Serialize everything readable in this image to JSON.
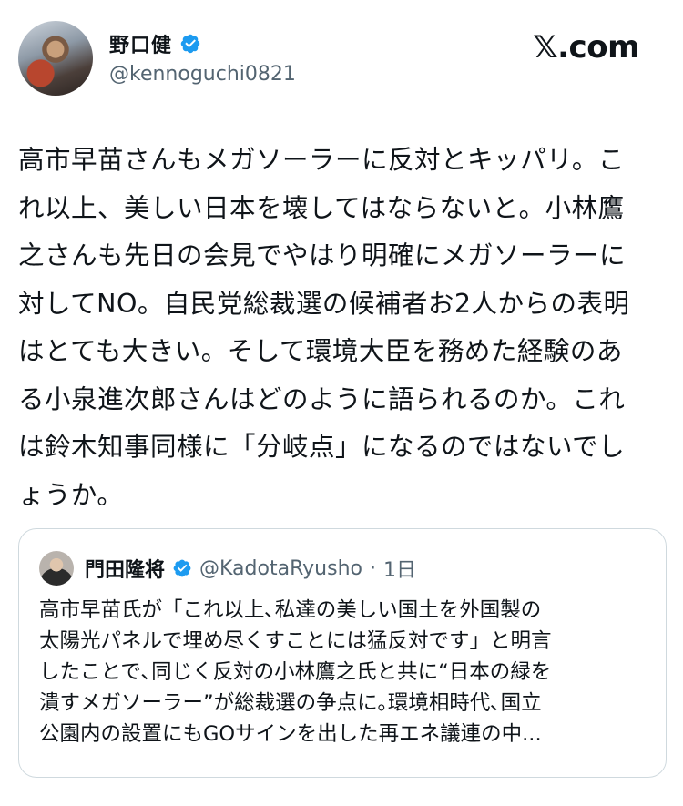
{
  "author": {
    "display_name": "野口健",
    "handle": "@kennoguchi0821",
    "verified": true
  },
  "brand": {
    "logo_text": "𝕏.com"
  },
  "tweet": {
    "text": "高市早苗さんもメガソーラーに反対とキッパリ。こ\nれ以上、美しい日本を壊してはならないと。小林鷹\n之さんも先日の会見でやはり明確にメガソーラーに\n対してNO。自民党総裁選の候補者お2人からの表明\nはとても大きい。そして環境大臣を務めた経験のあ\nる小泉進次郎さんはどのように語られるのか。これ\nは鈴木知事同様に「分岐点」になるのではないでし\nょうか。"
  },
  "quoted": {
    "display_name": "門田隆将",
    "handle": "@KadotaRyusho",
    "separator": "·",
    "time": "1日",
    "verified": true,
    "text": "高市早苗氏が「これ以上､私達の美しい国土を外国製の\n太陽光パネルで埋め尽くすことには猛反対です」と明言\nしたことで､同じく反対の小林鷹之氏と共に“日本の緑を\n潰すメガソーラー”が総裁選の争点に｡環境相時代､国立\n公園内の設置にもGOサインを出した再エネ議連の中..."
  },
  "colors": {
    "verified_blue": "#1d9bf0",
    "text": "#0f1419",
    "secondary": "#536471",
    "border": "#cfd9de"
  }
}
